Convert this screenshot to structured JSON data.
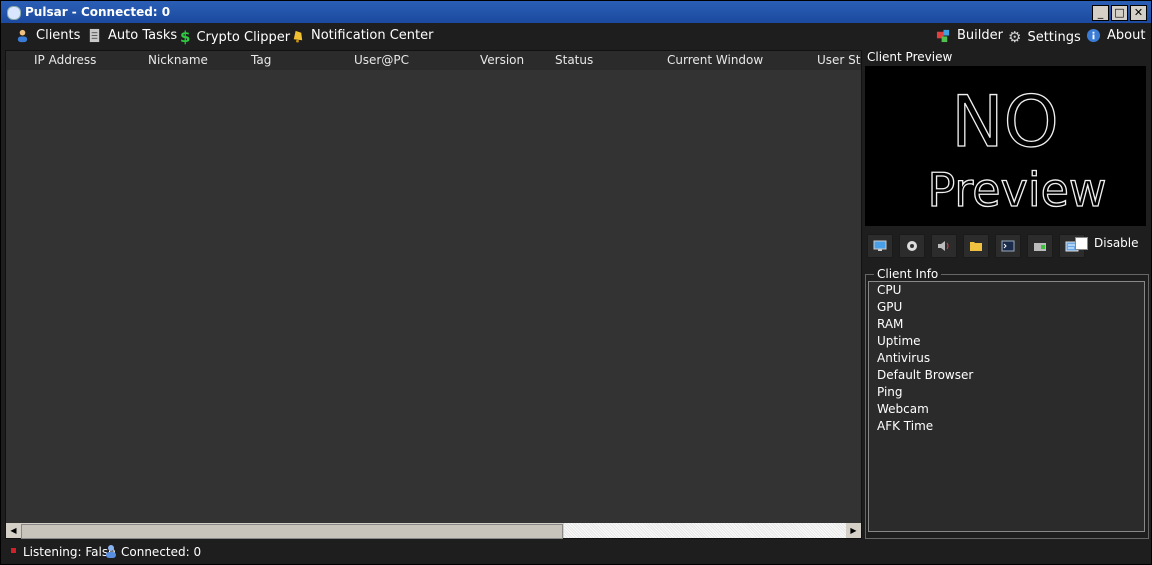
{
  "window": {
    "title": "Pulsar - Connected: 0",
    "controls": [
      "minimize",
      "maximize",
      "close"
    ]
  },
  "menu": {
    "left": [
      {
        "label": "Clients",
        "icon": "users-icon"
      },
      {
        "label": "Auto Tasks",
        "icon": "tasks-icon"
      },
      {
        "label": "Crypto Clipper",
        "icon": "dollar-icon"
      },
      {
        "label": "Notification Center",
        "icon": "bell-icon"
      }
    ],
    "right": [
      {
        "label": "Builder",
        "icon": "builder-icon"
      },
      {
        "label": "Settings",
        "icon": "gear-icon"
      },
      {
        "label": "About",
        "icon": "info-icon"
      }
    ]
  },
  "clients_table": {
    "columns": [
      "IP Address",
      "Nickname",
      "Tag",
      "User@PC",
      "Version",
      "Status",
      "Current Window",
      "User Sta"
    ],
    "rows": []
  },
  "right_panel": {
    "preview_label": "Client Preview",
    "preview_text": [
      "NO",
      "Preview"
    ],
    "tools": [
      "remote-desktop-icon",
      "webcam-icon",
      "audio-icon",
      "file-manager-icon",
      "shell-icon",
      "tasks-manager-icon",
      "system-info-icon"
    ],
    "disable_label": "Disable",
    "client_info_title": "Client Info",
    "client_info_items": [
      "CPU",
      "GPU",
      "RAM",
      "Uptime",
      "Antivirus",
      "Default Browser",
      "Ping",
      "Webcam",
      "AFK Time"
    ]
  },
  "status": {
    "listening": "Listening: False",
    "connected": "Connected: 0"
  },
  "colors": {
    "accent": "#2a5fb6",
    "background": "#1e1e1e",
    "list_bg": "#333333",
    "status_dot": "#d0202a"
  }
}
